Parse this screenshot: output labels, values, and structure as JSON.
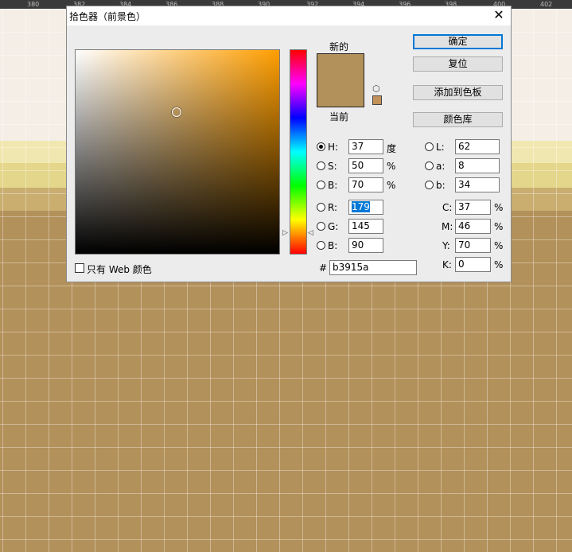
{
  "ruler": {
    "ticks": [
      "380",
      "382",
      "384",
      "386",
      "388",
      "390",
      "392",
      "394",
      "396",
      "398",
      "400",
      "402"
    ]
  },
  "dialog": {
    "title": "拾色器（前景色）",
    "close_glyph": "✕",
    "new_label": "新的",
    "current_label": "当前",
    "new_color": "#b3915a",
    "buttons": {
      "ok": "确定",
      "reset": "复位",
      "add_to_swatches": "添加到色板",
      "libraries": "颜色库"
    },
    "hsb": {
      "h": {
        "label": "H:",
        "value": "37",
        "unit": "度"
      },
      "s": {
        "label": "S:",
        "value": "50",
        "unit": "%"
      },
      "b": {
        "label": "B:",
        "value": "70",
        "unit": "%"
      }
    },
    "rgb": {
      "r": {
        "label": "R:",
        "value": "179"
      },
      "g": {
        "label": "G:",
        "value": "145"
      },
      "b": {
        "label": "B:",
        "value": "90"
      }
    },
    "lab": {
      "l": {
        "label": "L:",
        "value": "62"
      },
      "a": {
        "label": "a:",
        "value": "8"
      },
      "b": {
        "label": "b:",
        "value": "34"
      }
    },
    "cmyk": {
      "c": {
        "label": "C:",
        "value": "37",
        "unit": "%"
      },
      "m": {
        "label": "M:",
        "value": "46",
        "unit": "%"
      },
      "y": {
        "label": "Y:",
        "value": "70",
        "unit": "%"
      },
      "k": {
        "label": "K:",
        "value": "0",
        "unit": "%"
      }
    },
    "hex": {
      "label": "#",
      "value": "b3915a"
    },
    "web_only": {
      "label": "只有 Web 颜色",
      "checked": false
    },
    "hue_markers": {
      "left": "▷",
      "right": "◁"
    },
    "cube_glyph": "⬡"
  }
}
